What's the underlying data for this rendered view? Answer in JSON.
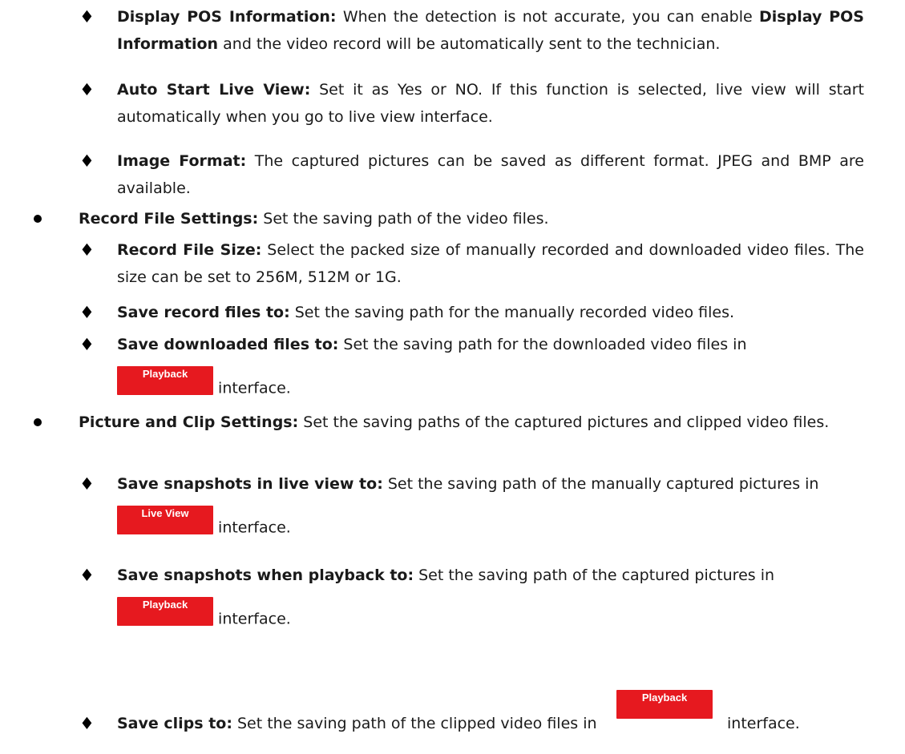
{
  "diamond_glyph": "♦",
  "items": {
    "display_pos": {
      "term": "Display POS Information:",
      "t1": " When the detection is not accurate, you can enable ",
      "term2": "Display POS Information",
      "t2": " and the video record will be automatically sent to the technician."
    },
    "auto_start": {
      "term": "Auto Start Live View:",
      "t1": " Set it as Yes or NO. If this function is selected, live view will start automatically when you go to live view interface."
    },
    "image_format": {
      "term": "Image Format:",
      "t1": " The captured pictures can be saved as different format. JPEG and BMP are available."
    },
    "record_settings": {
      "term": "Record File Settings:",
      "t1": " Set the saving path of the video files."
    },
    "record_size": {
      "term": "Record File Size:",
      "t1": " Select the packed size of manually recorded and downloaded video files. The size can be set to 256M, 512M or 1G."
    },
    "save_record": {
      "term": "Save record files to:",
      "t1": " Set the saving path for the manually recorded video files."
    },
    "save_downloaded": {
      "term": "Save downloaded files to:",
      "t1": " Set the saving path for the downloaded video files in",
      "button": "Playback",
      "t2": " interface."
    },
    "picture_clip": {
      "term": "Picture and Clip Settings:",
      "t1": " Set the saving paths of the captured pictures and clipped video files."
    },
    "snap_live": {
      "term": "Save snapshots in live view to:",
      "t1": " Set the saving path of the manually captured pictures in",
      "button": "Live View",
      "t2": " interface."
    },
    "snap_playback": {
      "term": "Save snapshots when playback to:",
      "t1": " Set the saving path of the captured pictures in",
      "button": "Playback",
      "t2": " interface."
    },
    "save_clips": {
      "term": "Save clips to:",
      "t1": " Set the saving path of the clipped video files in",
      "button": "Playback",
      "t2": " interface."
    }
  }
}
